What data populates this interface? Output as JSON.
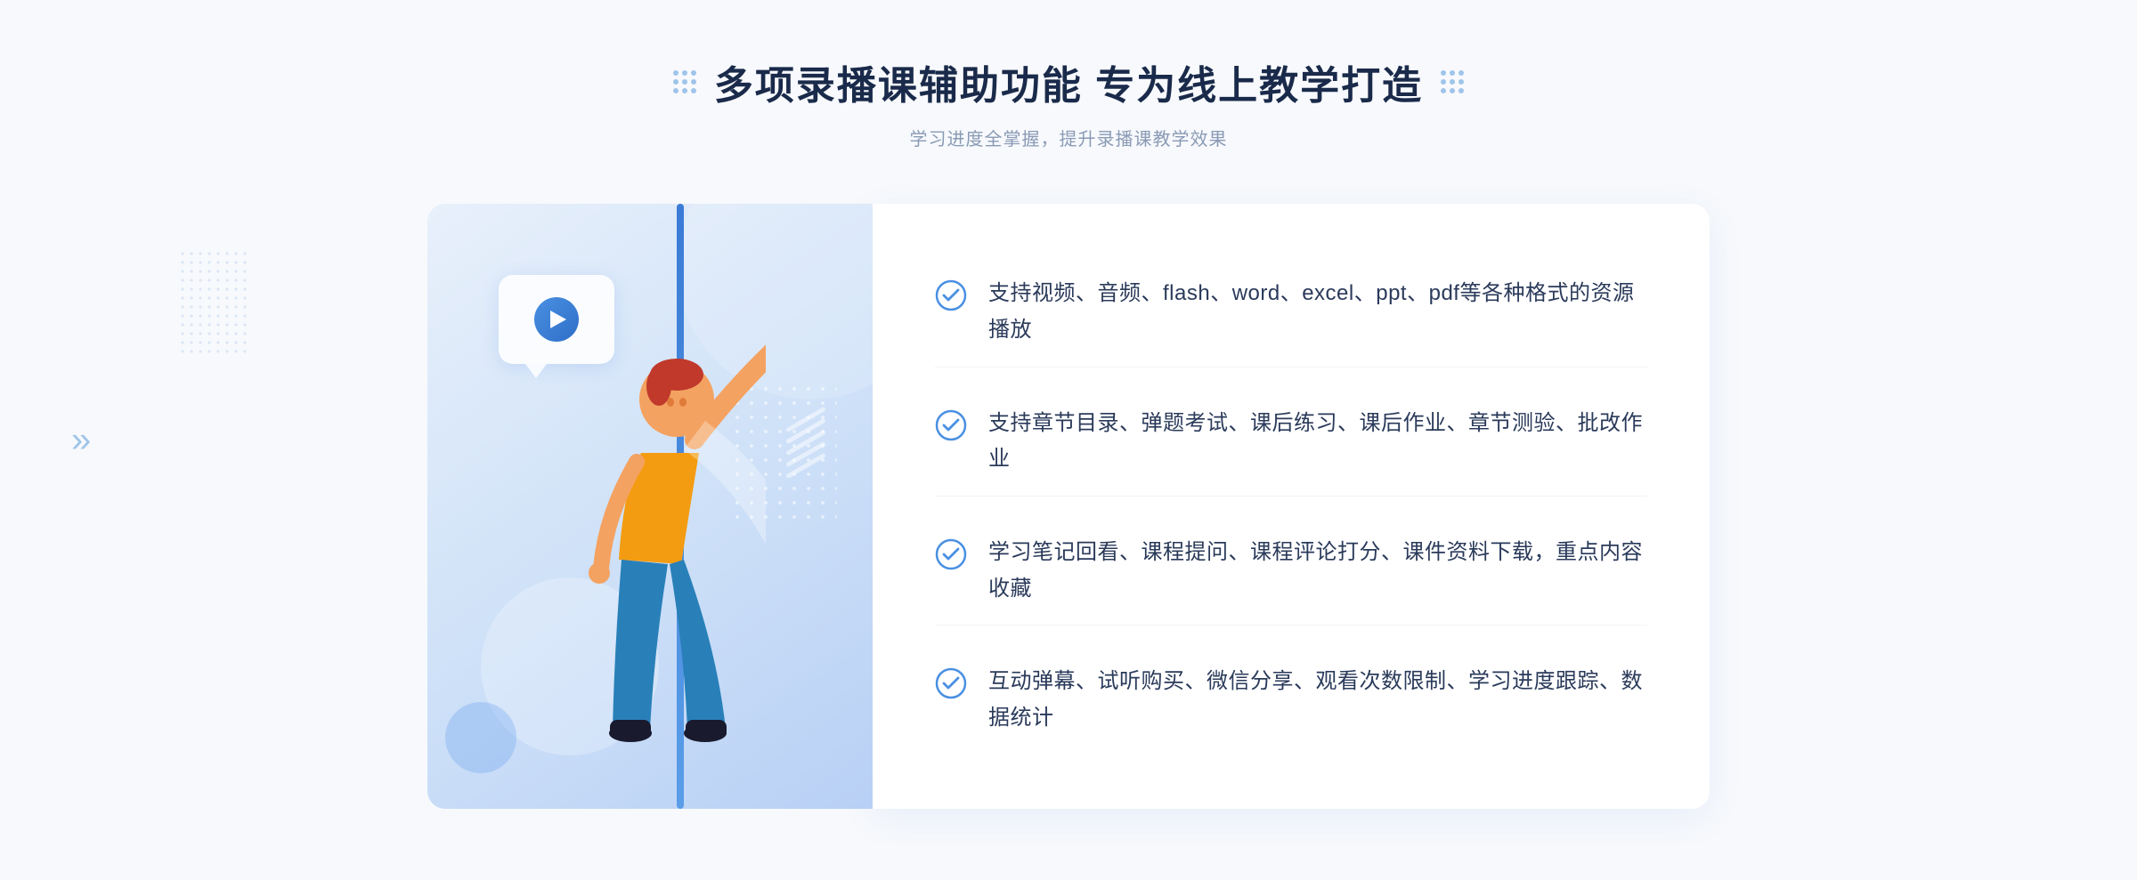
{
  "header": {
    "title": "多项录播课辅助功能 专为线上教学打造",
    "subtitle": "学习进度全掌握，提升录播课教学效果"
  },
  "features": [
    {
      "id": 1,
      "text": "支持视频、音频、flash、word、excel、ppt、pdf等各种格式的资源播放"
    },
    {
      "id": 2,
      "text": "支持章节目录、弹题考试、课后练习、课后作业、章节测验、批改作业"
    },
    {
      "id": 3,
      "text": "学习笔记回看、课程提问、课程评论打分、课件资料下载，重点内容收藏"
    },
    {
      "id": 4,
      "text": "互动弹幕、试听购买、微信分享、观看次数限制、学习进度跟踪、数据统计"
    }
  ],
  "decorations": {
    "chevron_left": "»",
    "play_label": "play"
  },
  "colors": {
    "accent_blue": "#4a90e2",
    "dark_blue": "#2e6fc8",
    "text_dark": "#2a3a5a",
    "text_light": "#8a9ab5",
    "check_color": "#4a90e2"
  }
}
